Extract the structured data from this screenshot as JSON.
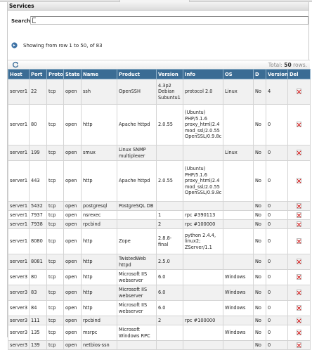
{
  "panel": {
    "title": "Services"
  },
  "search": {
    "label": "Search",
    "value": ""
  },
  "pager": {
    "showing_text": "Showing from row 1 to 50, of 83"
  },
  "summary": {
    "total_label": "Total:",
    "total_count": "50",
    "total_unit": "rows."
  },
  "columns": [
    "Host",
    "Port",
    "Proto",
    "State",
    "Name",
    "Product",
    "Version",
    "Info",
    "OS",
    "D",
    "Version",
    "Del"
  ],
  "rows": [
    {
      "host": "server1",
      "port": "22",
      "proto": "tcp",
      "state": "open",
      "name": "ssh",
      "product": "OpenSSH",
      "version": "4.3p2\nDebian\nSubuntu1",
      "info": "protocol 2.0",
      "os": "Linux",
      "d": "No",
      "version2": "4"
    },
    {
      "host": "server1",
      "port": "80",
      "proto": "tcp",
      "state": "open",
      "name": "http",
      "product": "Apache httpd",
      "version": "2.0.55",
      "info": "(Ubuntu)\nPHP/5.1.6\nproxy_html/2.4\nmod_ssl/2.0.55\nOpenSSL/0.9.8c",
      "os": "",
      "d": "No",
      "version2": "0"
    },
    {
      "host": "server1",
      "port": "199",
      "proto": "tcp",
      "state": "open",
      "name": "smux",
      "product": "Linux SNMP\nmultiplexer",
      "version": "",
      "info": "",
      "os": "Linux",
      "d": "No",
      "version2": "0"
    },
    {
      "host": "server1",
      "port": "443",
      "proto": "tcp",
      "state": "open",
      "name": "http",
      "product": "Apache httpd",
      "version": "2.0.55",
      "info": "(Ubuntu)\nPHP/5.1.6\nproxy_html/2.4\nmod_ssl/2.0.55\nOpenSSL/0.9.8c",
      "os": "",
      "d": "No",
      "version2": "0"
    },
    {
      "host": "server1",
      "port": "5432",
      "proto": "tcp",
      "state": "open",
      "name": "postgresql",
      "product": "PostgreSQL DB",
      "version": "",
      "info": "",
      "os": "",
      "d": "No",
      "version2": "0"
    },
    {
      "host": "server1",
      "port": "7937",
      "proto": "tcp",
      "state": "open",
      "name": "nsrexec",
      "product": "",
      "version": "1",
      "info": "rpc #390113",
      "os": "",
      "d": "No",
      "version2": "0"
    },
    {
      "host": "server1",
      "port": "7938",
      "proto": "tcp",
      "state": "open",
      "name": "rpcbind",
      "product": "",
      "version": "2",
      "info": "rpc #100000",
      "os": "",
      "d": "No",
      "version2": "0"
    },
    {
      "host": "server1",
      "port": "8080",
      "proto": "tcp",
      "state": "open",
      "name": "http",
      "product": "Zope",
      "version": "2.8.8-final",
      "info": "python 2.4.4,\nlinux2;\nZServer/1.1",
      "os": "",
      "d": "No",
      "version2": "0"
    },
    {
      "host": "server1",
      "port": "8081",
      "proto": "tcp",
      "state": "open",
      "name": "http",
      "product": "TwistedWeb\nhttpd",
      "version": "2.5.0",
      "info": "",
      "os": "",
      "d": "No",
      "version2": "0"
    },
    {
      "host": "server3",
      "port": "80",
      "proto": "tcp",
      "state": "open",
      "name": "http",
      "product": "Microsoft IIS\nwebserver",
      "version": "6.0",
      "info": "",
      "os": "Windows",
      "d": "No",
      "version2": "0"
    },
    {
      "host": "server3",
      "port": "83",
      "proto": "tcp",
      "state": "open",
      "name": "http",
      "product": "Microsoft IIS\nwebserver",
      "version": "6.0",
      "info": "",
      "os": "Windows",
      "d": "No",
      "version2": "0"
    },
    {
      "host": "server3",
      "port": "84",
      "proto": "tcp",
      "state": "open",
      "name": "http",
      "product": "Microsoft IIS\nwebserver",
      "version": "6.0",
      "info": "",
      "os": "Windows",
      "d": "No",
      "version2": "0"
    },
    {
      "host": "server3",
      "port": "111",
      "proto": "tcp",
      "state": "open",
      "name": "rpcbind",
      "product": "",
      "version": "2",
      "info": "rpc #100000",
      "os": "",
      "d": "No",
      "version2": "0"
    },
    {
      "host": "server3",
      "port": "135",
      "proto": "tcp",
      "state": "open",
      "name": "msrpc",
      "product": "Microsoft\nWindows RPC",
      "version": "",
      "info": "",
      "os": "Windows",
      "d": "No",
      "version2": "0"
    },
    {
      "host": "server3",
      "port": "139",
      "proto": "tcp",
      "state": "open",
      "name": "netbios-ssn",
      "product": "",
      "version": "",
      "info": "",
      "os": "",
      "d": "No",
      "version2": "0"
    }
  ],
  "colors": {
    "header_bg": "#3b6c94",
    "row_alt": "#f1f1f1",
    "delete_red": "#d11b1b"
  }
}
